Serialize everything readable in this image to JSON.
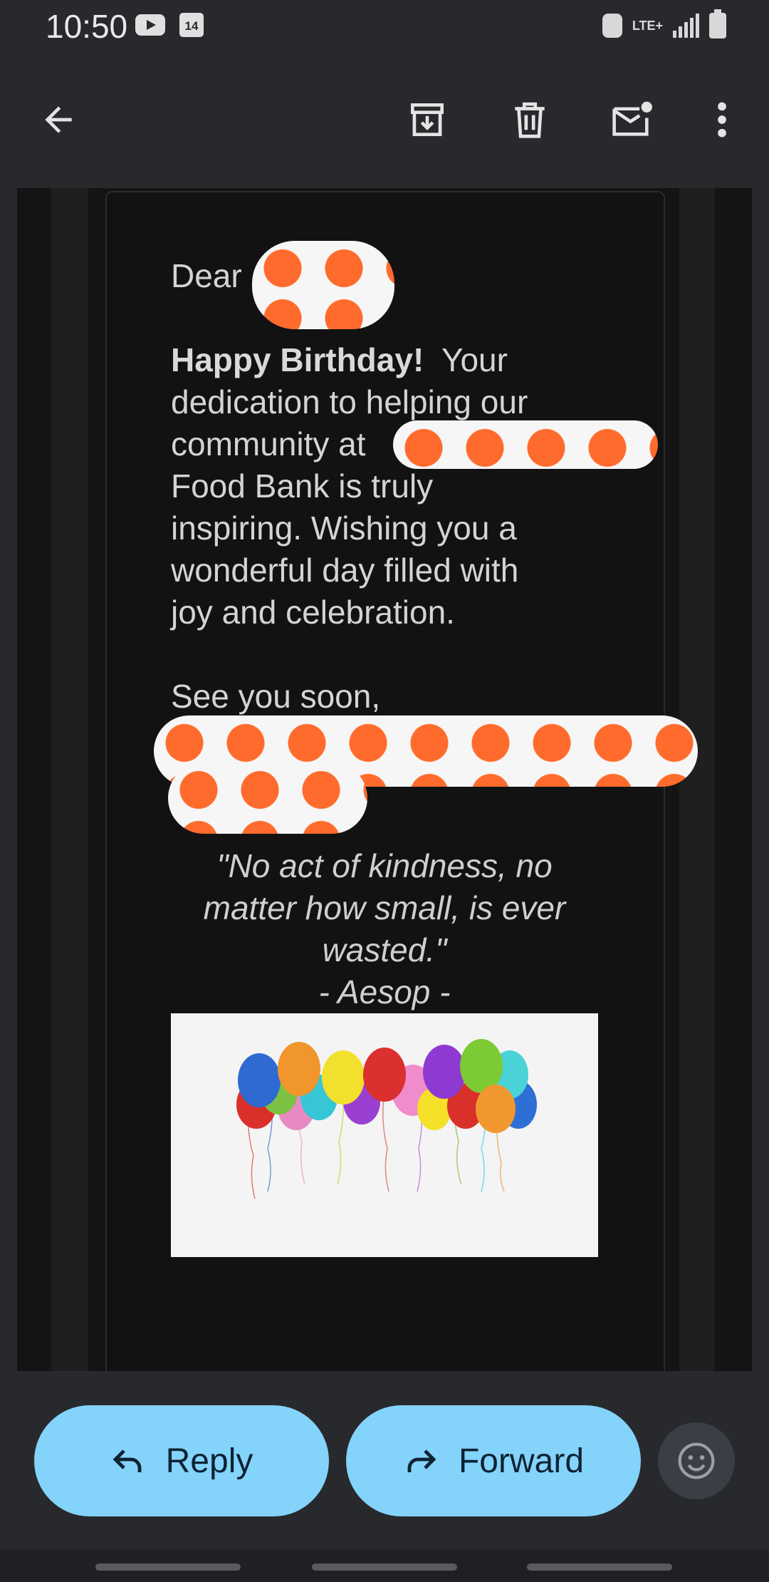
{
  "status_bar": {
    "time": "10:50",
    "calendar_day": "14",
    "network": "LTE+"
  },
  "app_bar": {
    "icons": [
      "back-arrow-icon",
      "archive-icon",
      "delete-icon",
      "mark-unread-icon",
      "more-vert-icon"
    ]
  },
  "email": {
    "greeting": "Dear",
    "body_bold": "Happy Birthday!",
    "body_lines": [
      "Your",
      "dedication to helping our",
      "community at",
      "Food Bank is truly",
      "inspiring. Wishing you a",
      "wonderful day filled with",
      "joy and celebration."
    ],
    "signoff": "See you soon,",
    "quote_lines": [
      "\"No act of kindness, no",
      "matter how small, is ever",
      "wasted.\"",
      "- Aesop -"
    ]
  },
  "actions": {
    "reply_label": "Reply",
    "forward_label": "Forward"
  },
  "colors": {
    "accent_pill": "#84d3fb",
    "redaction_orange": "#ff6b2c",
    "background": "#28292d"
  }
}
